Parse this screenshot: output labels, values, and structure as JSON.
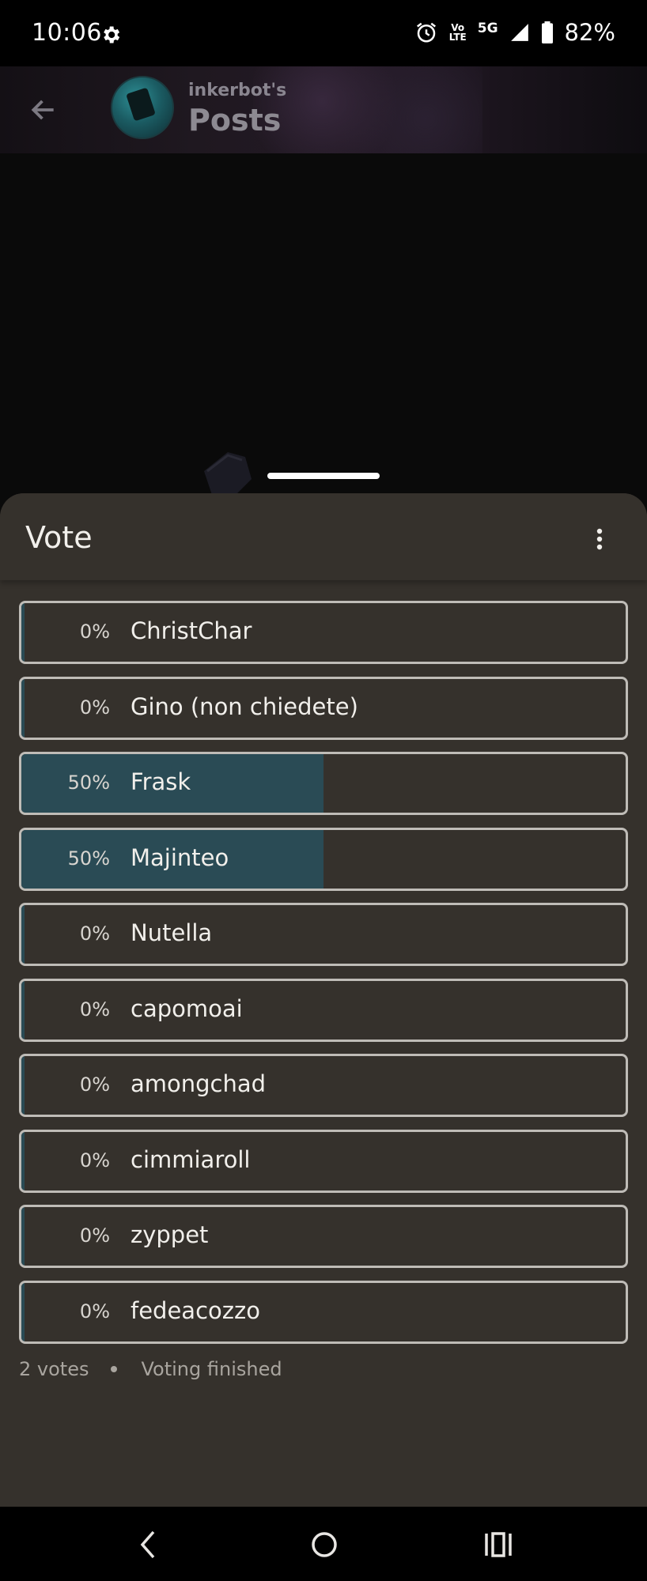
{
  "status_bar": {
    "time": "10:06",
    "network_volte_top": "Vo",
    "network_volte_bottom": "LTE",
    "network_gen": "5G",
    "battery": "82%",
    "icons": [
      "gear-icon",
      "alarm-icon",
      "signal-icon",
      "battery-icon"
    ]
  },
  "header": {
    "subtitle": "inkerbot's",
    "title": "Posts",
    "back_icon": "arrow-left-icon"
  },
  "sheet": {
    "title": "Vote",
    "menu_icon": "more-vertical-icon",
    "options": [
      {
        "percent_label": "0%",
        "label": "ChristChar",
        "fraction": 0.0
      },
      {
        "percent_label": "0%",
        "label": "Gino (non chiedete)",
        "fraction": 0.0
      },
      {
        "percent_label": "50%",
        "label": "Frask",
        "fraction": 0.5
      },
      {
        "percent_label": "50%",
        "label": "Majinteo",
        "fraction": 0.5
      },
      {
        "percent_label": "0%",
        "label": "Nutella",
        "fraction": 0.0
      },
      {
        "percent_label": "0%",
        "label": "capomoai",
        "fraction": 0.0
      },
      {
        "percent_label": "0%",
        "label": "amongchad",
        "fraction": 0.0
      },
      {
        "percent_label": "0%",
        "label": "cimmiaroll",
        "fraction": 0.0
      },
      {
        "percent_label": "0%",
        "label": "zyppet",
        "fraction": 0.0
      },
      {
        "percent_label": "0%",
        "label": "fedeacozzo",
        "fraction": 0.0
      }
    ],
    "votes": "2 votes",
    "status": "Voting finished"
  },
  "colors": {
    "sheet_bg": "#35312c",
    "bar_fill": "#2a4b55",
    "option_border": "#bfbcb7"
  },
  "nav": {
    "icons": [
      "nav-back-icon",
      "nav-home-icon",
      "nav-recents-icon"
    ]
  }
}
